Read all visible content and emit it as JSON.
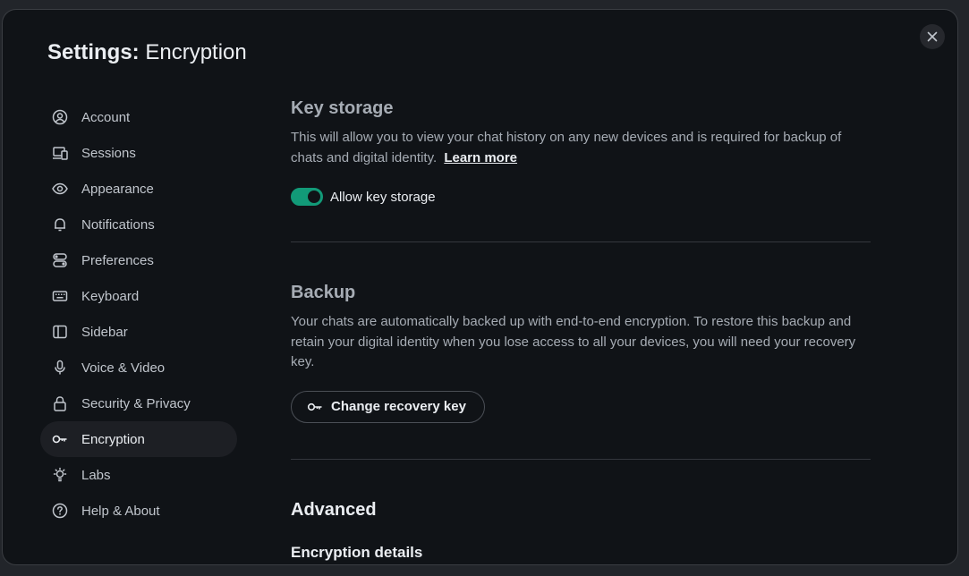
{
  "dialog": {
    "title_prefix": "Settings:",
    "title_section": "Encryption",
    "close_icon": "close-icon"
  },
  "sidebar": {
    "items": [
      {
        "label": "Account",
        "icon": "user-circle-icon",
        "active": false
      },
      {
        "label": "Sessions",
        "icon": "devices-icon",
        "active": false
      },
      {
        "label": "Appearance",
        "icon": "eye-icon",
        "active": false
      },
      {
        "label": "Notifications",
        "icon": "bell-icon",
        "active": false
      },
      {
        "label": "Preferences",
        "icon": "toggles-icon",
        "active": false
      },
      {
        "label": "Keyboard",
        "icon": "keyboard-icon",
        "active": false
      },
      {
        "label": "Sidebar",
        "icon": "sidebar-icon",
        "active": false
      },
      {
        "label": "Voice & Video",
        "icon": "microphone-icon",
        "active": false
      },
      {
        "label": "Security & Privacy",
        "icon": "lock-icon",
        "active": false
      },
      {
        "label": "Encryption",
        "icon": "key-icon",
        "active": true
      },
      {
        "label": "Labs",
        "icon": "lightbulb-icon",
        "active": false
      },
      {
        "label": "Help & About",
        "icon": "help-circle-icon",
        "active": false
      }
    ]
  },
  "key_storage": {
    "heading": "Key storage",
    "description": "This will allow you to view your chat history on any new devices and is required for backup of chats and digital identity.",
    "learn_more": "Learn more",
    "toggle_label": "Allow key storage",
    "toggle_on": true
  },
  "backup": {
    "heading": "Backup",
    "description": "Your chats are automatically backed up with end-to-end encryption. To restore this backup and retain your digital identity when you lose access to all your devices, you will need your recovery key.",
    "button_label": "Change recovery key"
  },
  "advanced": {
    "heading": "Advanced",
    "subheading": "Encryption details"
  },
  "colors": {
    "accent": "#129a78",
    "background": "#101317",
    "text_primary": "#ebeef2",
    "text_secondary": "#a6acb4"
  }
}
